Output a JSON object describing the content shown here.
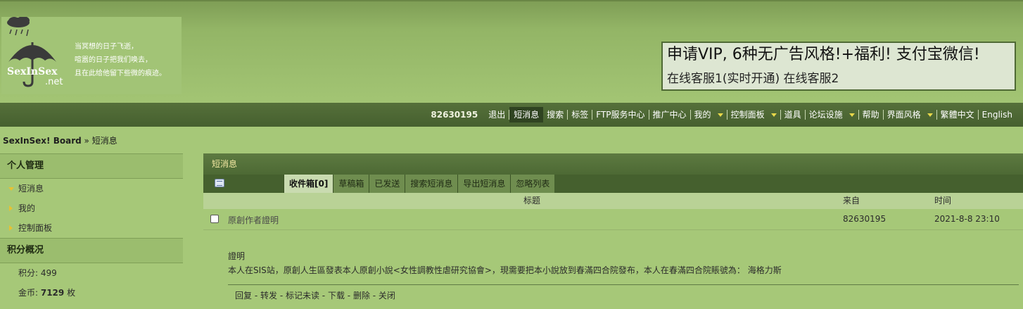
{
  "header": {
    "logo_text": "SexInSex",
    "logo_suffix": ".net",
    "tagline": [
      "当冥想的日子飞逝，",
      "喧嚣的日子把我们唤去，",
      "且在此给他留下些微的痕迹。"
    ],
    "vip_line1": "申请VIP, 6种无广告风格!+福利! 支付宝微信!",
    "service1": "在线客服1(实时开通)",
    "service2": "在线客服2"
  },
  "nav": {
    "user": "82630195",
    "items": [
      "退出",
      "短消息",
      "搜索",
      "标签",
      "FTP服务中心",
      "推广中心",
      "我的",
      "控制面板",
      "道具",
      "论坛设施",
      "帮助",
      "界面风格",
      "繁體中文",
      "English"
    ]
  },
  "breadcrumb": {
    "board": "SexInSex! Board",
    "sep": " » ",
    "current": "短消息"
  },
  "sidebar": {
    "section1": "个人管理",
    "items": [
      "短消息",
      "我的",
      "控制面板"
    ],
    "section2": "积分概况",
    "points_label": "积分: ",
    "points_value": "499",
    "coins_label": "金币: ",
    "coins_value": "7129",
    "coins_unit": " 枚"
  },
  "main": {
    "title": "短消息",
    "tabs": [
      "收件箱[0]",
      "草稿箱",
      "已发送",
      "搜索短消息",
      "导出短消息",
      "忽略列表"
    ],
    "columns": {
      "title": "标题",
      "from": "来自",
      "time": "时间"
    },
    "row": {
      "subject": "原創作者證明",
      "from": "82630195",
      "time": "2021-8-8 23:10"
    },
    "message_heading": "證明",
    "message_text": "本人在SIS站，原創人生區發表本人原創小說<女性調教性虐研究協會>，現需要把本小說放到春滿四合院發布，本人在春滿四合院賬號為： 海格力斯",
    "actions": [
      "回复",
      "转发",
      "标记未读",
      "下载",
      "删除",
      "关闭"
    ],
    "action_sep": " - "
  },
  "colors": {
    "accent_yellow": "#e7c232",
    "nav_dark": "#46602f",
    "page_bg": "#a6c878"
  }
}
